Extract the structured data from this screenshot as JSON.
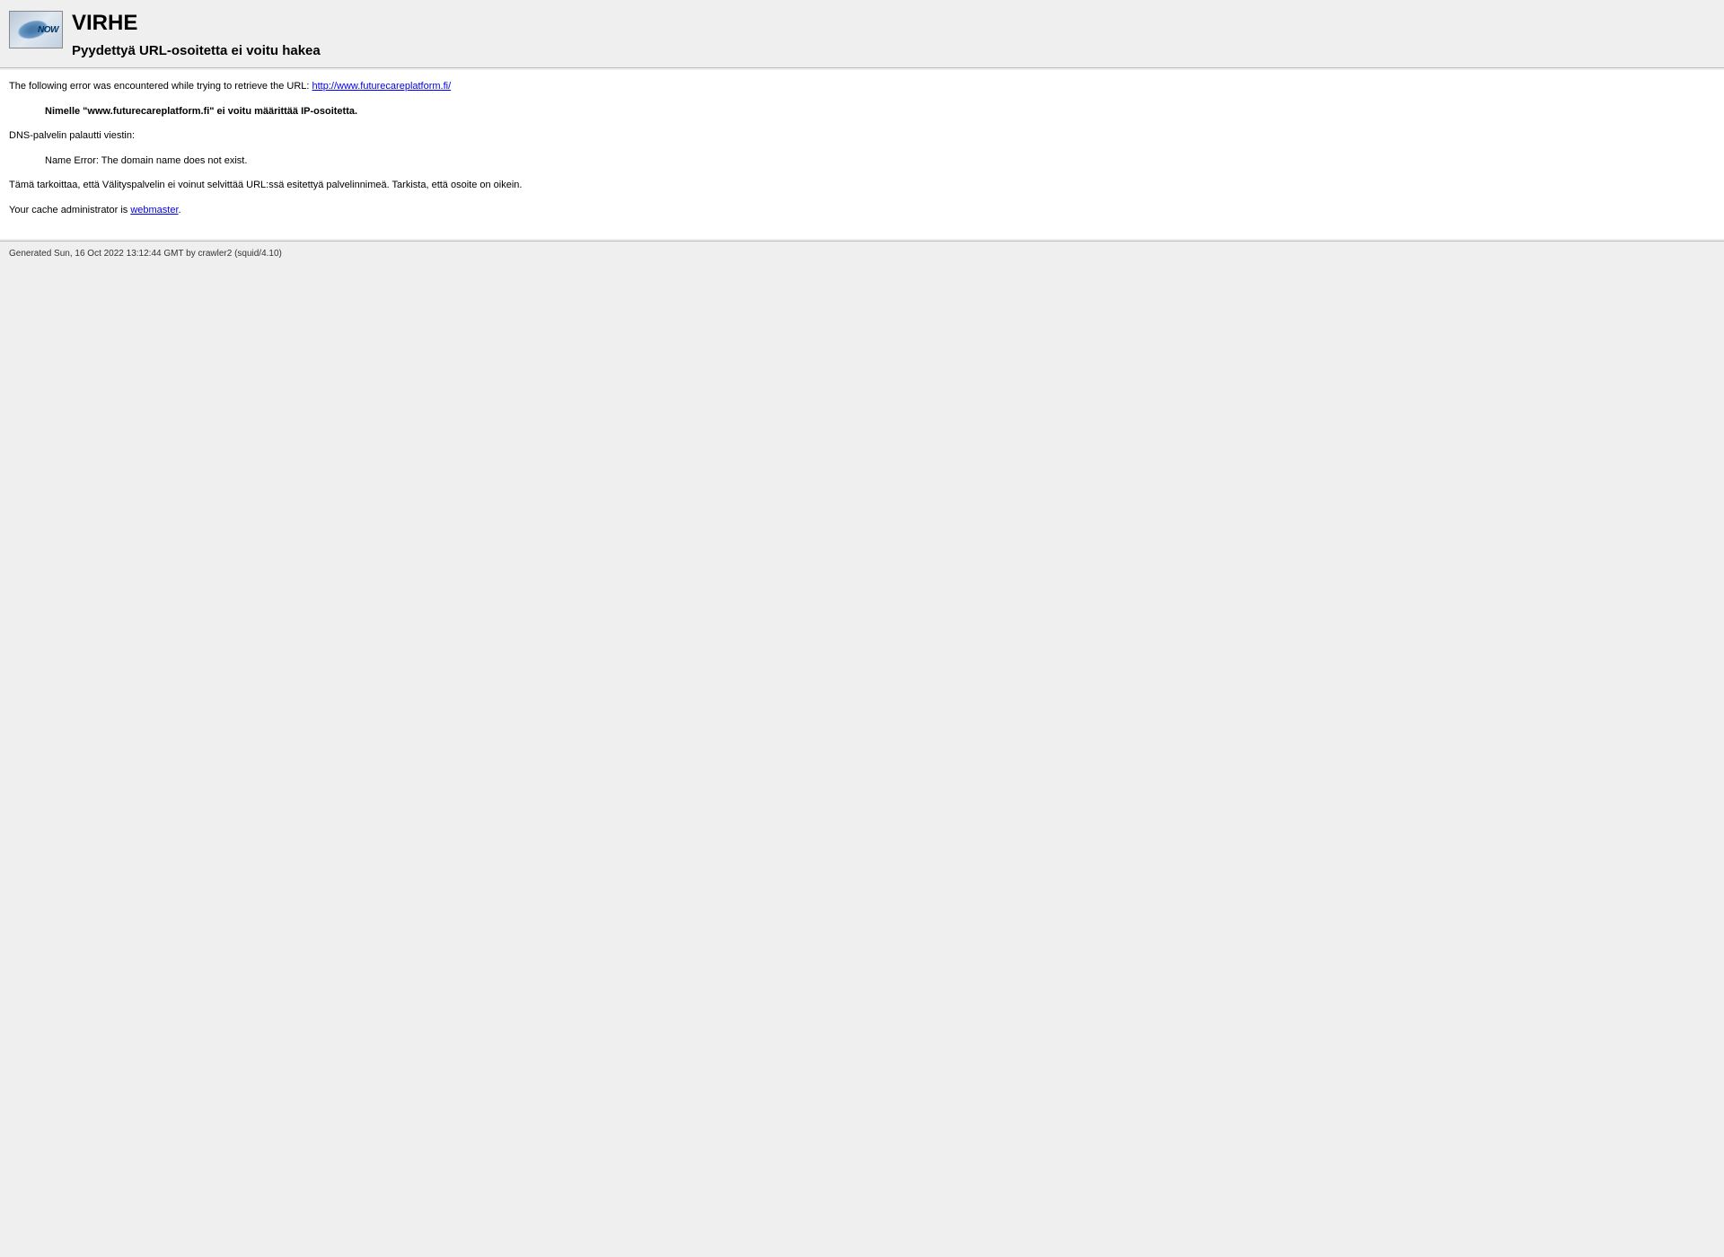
{
  "logo": {
    "text": "NOW"
  },
  "header": {
    "title": "VIRHE",
    "subtitle": "Pyydettyä URL-osoitetta ei voitu hakea"
  },
  "content": {
    "intro_text": "The following error was encountered while trying to retrieve the URL: ",
    "url": "http://www.futurecareplatform.fi/",
    "error_bold": "Nimelle \"www.futurecareplatform.fi\" ei voitu määrittää IP-osoitetta.",
    "dns_label": "DNS-palvelin palautti viestin:",
    "dns_message": "Name Error: The domain name does not exist.",
    "explanation": "Tämä tarkoittaa, että Välityspalvelin ei voinut selvittää URL:ssä esitettyä palvelinnimeä. Tarkista, että osoite on oikein.",
    "admin_text": "Your cache administrator is ",
    "admin_link": "webmaster",
    "admin_suffix": "."
  },
  "footer": {
    "generated": "Generated Sun, 16 Oct 2022 13:12:44 GMT by crawler2 (squid/4.10)"
  }
}
